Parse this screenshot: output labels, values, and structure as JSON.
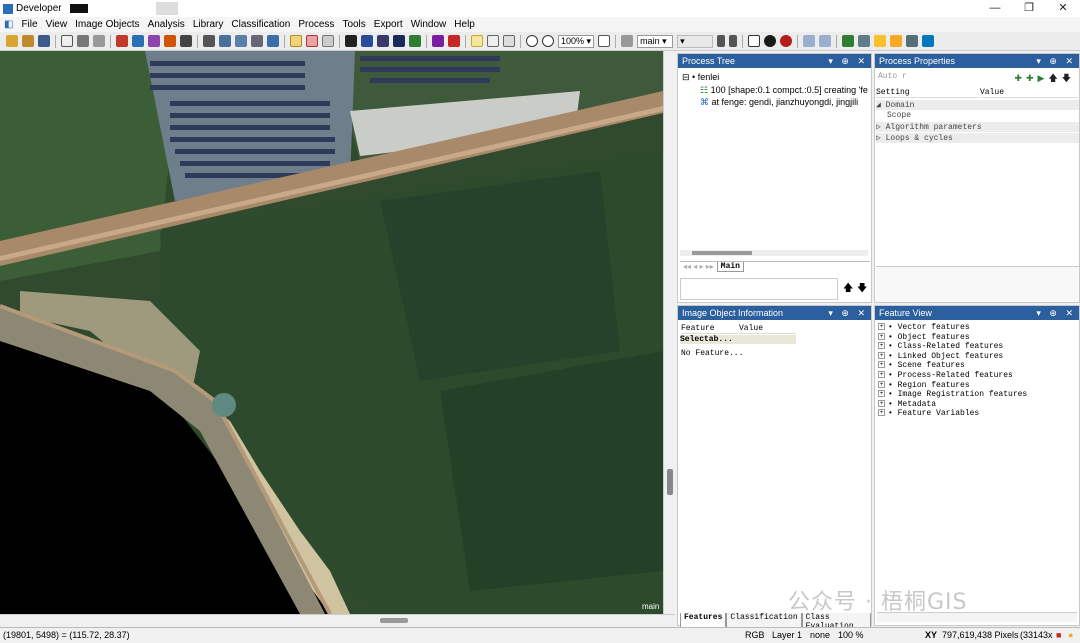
{
  "window": {
    "title": "Developer"
  },
  "menu": [
    "File",
    "View",
    "Image Objects",
    "Analysis",
    "Library",
    "Classification",
    "Process",
    "Tools",
    "Export",
    "Window",
    "Help"
  ],
  "toolbar": {
    "zoom": "100%",
    "map": "main",
    "level": ""
  },
  "view": {
    "label": "main"
  },
  "process_tree": {
    "title": "Process Tree",
    "root": "fenlei",
    "items": [
      "100 [shape:0.1 compct.:0.5] creating 'fe",
      "at  fenge: gendi, jianzhuyongdi, jingjili"
    ],
    "tab": "Main"
  },
  "process_properties": {
    "title": "Process Properties",
    "search_placeholder": "Auto r",
    "col_setting": "Setting",
    "col_value": "Value",
    "rows": [
      "Domain",
      "Scope",
      "Algorithm parameters",
      "Loops & cycles"
    ]
  },
  "image_object_info": {
    "title": "Image Object Information",
    "col_feature": "Feature",
    "col_value": "Value",
    "selected": "Selectab...",
    "empty": "No Feature...",
    "tabs": [
      "Features",
      "Classification",
      "Class Evaluation"
    ]
  },
  "feature_view": {
    "title": "Feature View",
    "items": [
      "Vector features",
      "Object features",
      "Class-Related features",
      "Linked Object features",
      "Scene features",
      "Process-Related features",
      "Region features",
      "Image Registration features",
      "Metadata",
      "Feature Variables"
    ]
  },
  "status": {
    "coords": "(19801, 5498) = (115.72, 28.37)",
    "mode": "RGB",
    "layer": "Layer 1",
    "none": "none",
    "zoom": "100 %",
    "xy": "XY",
    "pixels": "797,619,438 Pixels",
    "size": "(33143x"
  },
  "watermark": "公众号 · 梧桐GIS",
  "colors": {
    "panel_header": "#2c5f9e",
    "selected_row": "#e8e8d8"
  }
}
